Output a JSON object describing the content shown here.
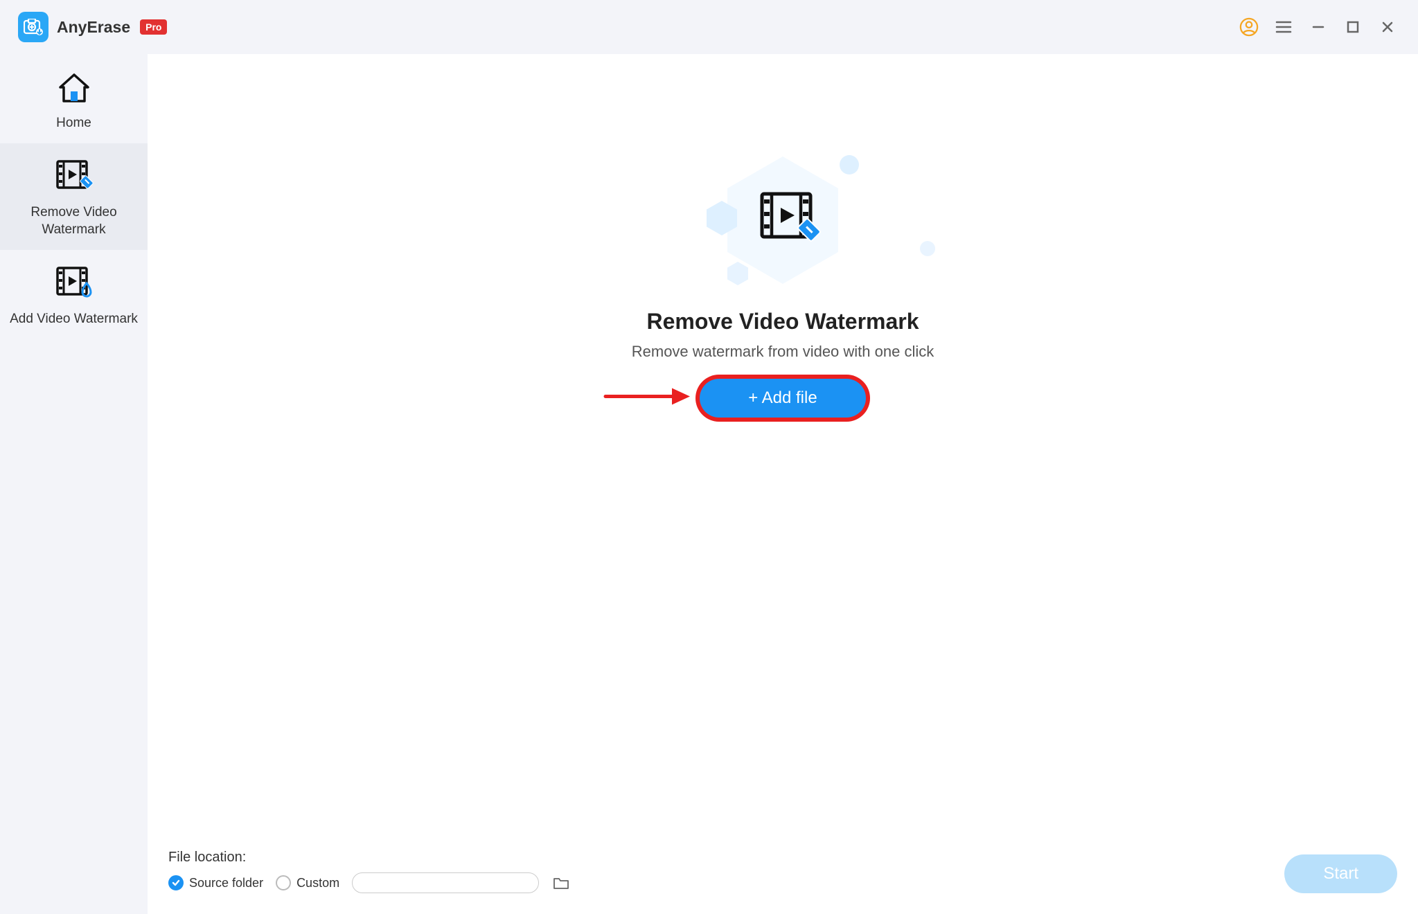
{
  "brand": {
    "name": "AnyErase",
    "badge": "Pro"
  },
  "icons": {
    "account": "account",
    "menu": "menu",
    "minimize": "minimize",
    "maximize": "maximize",
    "close": "close",
    "home": "home",
    "remove_video": "remove-video-watermark",
    "add_video": "add-video-watermark",
    "folder": "folder"
  },
  "sidebar": {
    "items": [
      {
        "label": "Home"
      },
      {
        "label": "Remove Video Watermark"
      },
      {
        "label": "Add Video Watermark"
      }
    ]
  },
  "hero": {
    "title": "Remove Video Watermark",
    "subtitle": "Remove watermark from video with one click",
    "add_file_label": "+ Add file"
  },
  "footer": {
    "file_location_label": "File location:",
    "source_label": "Source folder",
    "custom_label": "Custom",
    "custom_path": "",
    "start_label": "Start"
  }
}
